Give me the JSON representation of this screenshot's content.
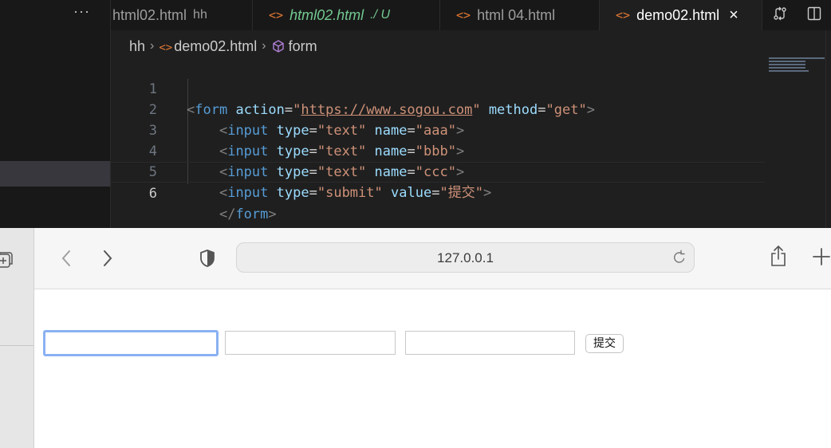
{
  "editor": {
    "more_label": "···",
    "tabs": [
      {
        "name": "html02.html",
        "description": "hh",
        "state": "inactive"
      },
      {
        "name": "html02.html",
        "description": "./ U",
        "state": "modified"
      },
      {
        "name": "html 04.html",
        "description": "",
        "state": "inactive"
      },
      {
        "name": "demo02.html",
        "description": "",
        "state": "active"
      }
    ],
    "tab_icon_glyph": "<>",
    "close_glyph": "×",
    "breadcrumb": {
      "folder": "hh",
      "file": "demo02.html",
      "symbol": "form"
    },
    "code_lines": [
      {
        "number": "1"
      },
      {
        "number": "2"
      },
      {
        "number": "3"
      },
      {
        "number": "4"
      },
      {
        "number": "5"
      },
      {
        "number": "6"
      }
    ],
    "code": {
      "form_tag": "form",
      "input_tag": "input",
      "action_attr": "action",
      "action_value": "https://www.sogou.com",
      "method_attr": "method",
      "method_value": "get",
      "type_attr": "type",
      "name_attr": "name",
      "value_attr": "value",
      "text_type": "text",
      "submit_type": "submit",
      "name_aaa": "aaa",
      "name_bbb": "bbb",
      "name_ccc": "ccc",
      "submit_value": "提交"
    },
    "colors": {
      "tag": "#569cd6",
      "attribute": "#9cdcfe",
      "string": "#ce9178",
      "html_icon": "#e37933",
      "modified": "#73c991"
    }
  },
  "browser": {
    "address": "127.0.0.1",
    "form": {
      "input_1": "",
      "input_2": "",
      "input_3": "",
      "submit_label": "提交"
    },
    "focus_color": "#8ab1f2"
  }
}
